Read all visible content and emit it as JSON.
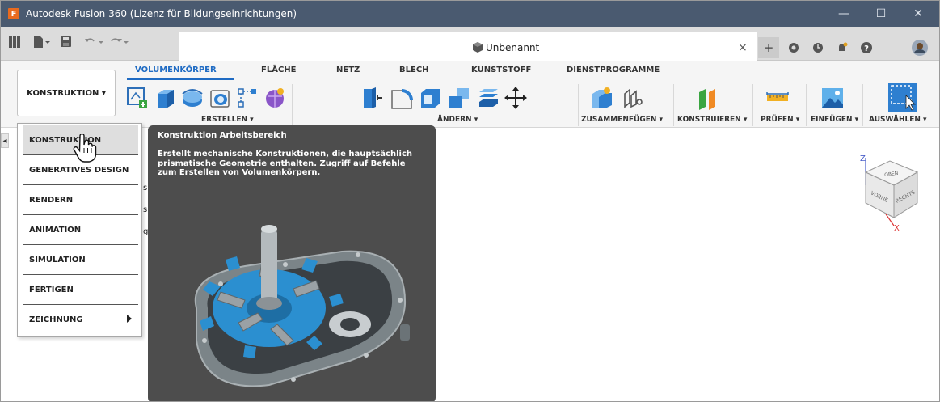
{
  "window": {
    "title": "Autodesk Fusion 360 (Lizenz für Bildungseinrichtungen)",
    "logo_letter": "F",
    "controls": [
      "—",
      "☐",
      "✕"
    ]
  },
  "document_tab": {
    "name": "Unbenannt",
    "close": "×"
  },
  "workspace_button": {
    "label": "KONSTRUKTION ▾"
  },
  "ribbon_tabs": [
    {
      "label": "VOLUMENKÖRPER",
      "active": true
    },
    {
      "label": "FLÄCHE"
    },
    {
      "label": "NETZ"
    },
    {
      "label": "BLECH"
    },
    {
      "label": "KUNSTSTOFF"
    },
    {
      "label": "DIENSTPROGRAMME"
    }
  ],
  "ribbon_groups": {
    "erstellen": "ERSTELLEN ▾",
    "aendern": "ÄNDERN ▾",
    "zusammenfuegen": "ZUSAMMENFÜGEN ▾",
    "konstruieren": "KONSTRUIEREN ▾",
    "pruefen": "PRÜFEN ▾",
    "einfuegen": "EINFÜGEN ▾",
    "auswaehlen": "AUSWÄHLEN ▾"
  },
  "workspace_menu": {
    "items": [
      {
        "label": "KONSTRUKTION",
        "highlighted": true
      },
      {
        "label": "GENERATIVES DESIGN"
      },
      {
        "label": "RENDERN"
      },
      {
        "label": "ANIMATION"
      },
      {
        "label": "SIMULATION"
      },
      {
        "label": "FERTIGEN"
      },
      {
        "label": "ZEICHNUNG",
        "has_submenu": true
      }
    ]
  },
  "tooltip": {
    "title": "Konstruktion Arbeitsbereich",
    "description": "Erstellt mechanische Konstruktionen, die hauptsächlich prismatische Geometrie enthalten. Zugriff auf Befehle zum Erstellen von Volumenkörpern."
  },
  "viewcube": {
    "top": "OBEN",
    "front": "VORNE",
    "right": "RECHTS",
    "axis_x": "X",
    "axis_z": "Z"
  },
  "browser_peek": {
    "left_arrow": "◂",
    "fragments": [
      "sl",
      "si",
      "g"
    ]
  },
  "colors": {
    "titlebar": "#4a5a70",
    "accent": "#1f6bc3",
    "tooltip_bg": "#4d4d4d",
    "menu_highlight": "#dedede",
    "gear_blue": "#2b8fd0"
  }
}
